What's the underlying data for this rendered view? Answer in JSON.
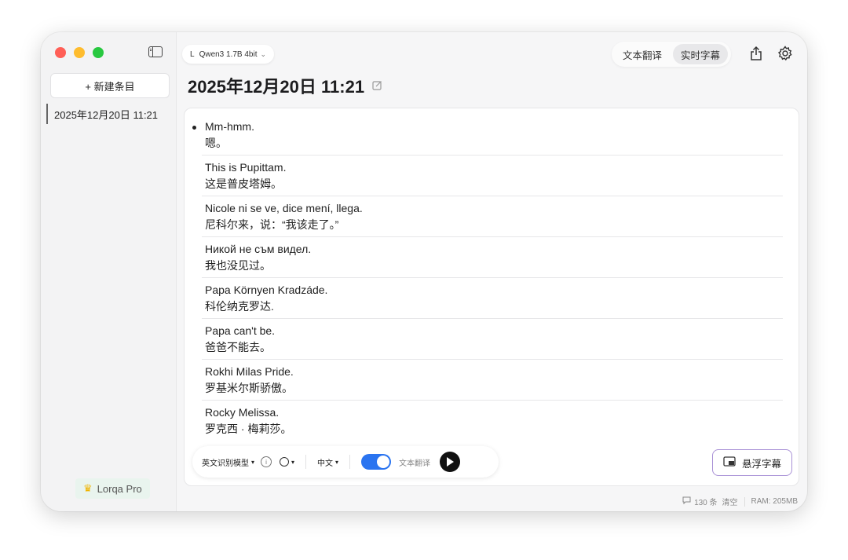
{
  "sidebar": {
    "new_item_label": "+ 新建条目",
    "sessions": [
      "2025年12月20日 11:21"
    ],
    "pro_label": "Lorqa Pro"
  },
  "header": {
    "model_prefix": "L",
    "model_name": "Qwen3 1.7B 4bit",
    "mode_text_translation": "文本翻译",
    "mode_live_subtitles": "实时字幕",
    "title": "2025年12月20日 11:21"
  },
  "entries": [
    {
      "src": "Mm-hmm.",
      "dst": "嗯。"
    },
    {
      "src": "This is Pupittam.",
      "dst": "这是普皮塔姆。"
    },
    {
      "src": "Nicole ni se ve, dice mení, llega.",
      "dst": "尼科尔来，说：“我该走了。”"
    },
    {
      "src": "Никой не съм видел.",
      "dst": "我也没见过。"
    },
    {
      "src": "Papa Környen Kradzáde.",
      "dst": "科伦纳克罗达."
    },
    {
      "src": "Papa can't be.",
      "dst": "爸爸不能去。"
    },
    {
      "src": "Rokhi Milas Pride.",
      "dst": "罗基米尔斯骄傲。"
    },
    {
      "src": "Rocky Melissa.",
      "dst": "罗克西 · 梅莉莎。"
    }
  ],
  "controls": {
    "recognition_model": "英文识别模型",
    "language": "中文",
    "toggle_label": "文本翻译",
    "toggle_on": true,
    "float_subtitles": "悬浮字幕"
  },
  "status": {
    "count": "130 条",
    "clear": "清空",
    "ram": "RAM: 205MB"
  },
  "colors": {
    "close": "#ff5f57",
    "minimize": "#febc2e",
    "zoom": "#28c840",
    "accent": "#2a74f0",
    "float_border": "#a991d6"
  }
}
